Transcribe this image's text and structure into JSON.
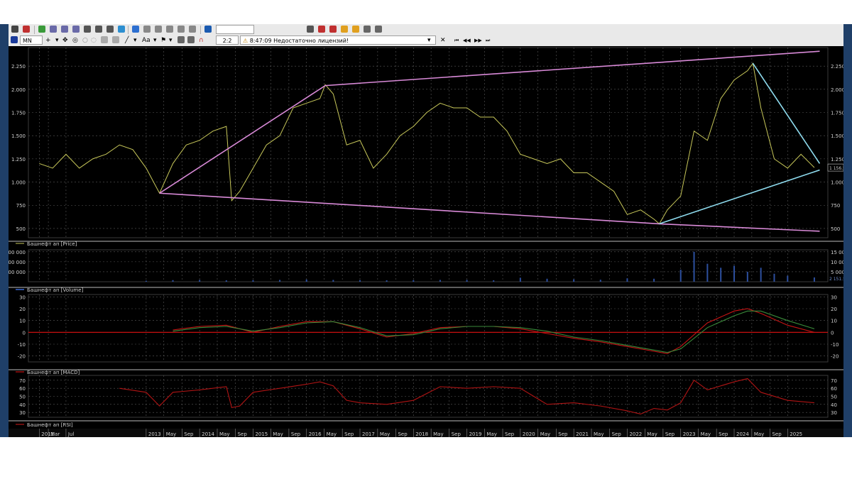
{
  "toolbar": {
    "timeframe": "MN",
    "ratio": "2:2",
    "aa_label": "Aa",
    "status_time": "8:47:09",
    "status_message": "Недостаточно лицензий!",
    "nav_labels": [
      "⏮",
      "◀◀",
      "▶▶",
      "⏭"
    ]
  },
  "colors": {
    "background": "#000000",
    "grid": "#5a5a5a",
    "price_line": "#c8c85a",
    "trend_pink": "#d98ad8",
    "trend_cyan": "#8fdcef",
    "volume_bar": "#2d4f9e",
    "macd_red": "#c81414",
    "macd_green": "#3a8a3a",
    "rsi_red": "#b01414"
  },
  "panels": {
    "price_legend": "Башнефт ап [Price]",
    "volume_legend": "Башнефт ап [Volume]",
    "macd_legend": "Башнефт ап [MACD]",
    "rsi_legend": "Башнефт ап [RSI]",
    "last_price_label": "1 156.5",
    "volume_last_label": "2 151.5"
  },
  "chart_data": [
    {
      "type": "line",
      "panel": "price",
      "series": [
        {
          "name": "Башнефт ап [Price]",
          "x": [
            2011.0,
            2011.25,
            2011.5,
            2011.75,
            2012.0,
            2012.25,
            2012.5,
            2012.75,
            2013.0,
            2013.25,
            2013.5,
            2013.75,
            2014.0,
            2014.25,
            2014.5,
            2014.6,
            2014.75,
            2015.0,
            2015.25,
            2015.5,
            2015.75,
            2016.0,
            2016.25,
            2016.35,
            2016.5,
            2016.75,
            2017.0,
            2017.25,
            2017.5,
            2017.75,
            2018.0,
            2018.25,
            2018.5,
            2018.75,
            2019.0,
            2019.25,
            2019.5,
            2019.75,
            2020.0,
            2020.25,
            2020.5,
            2020.75,
            2021.0,
            2021.25,
            2021.5,
            2021.75,
            2022.0,
            2022.25,
            2022.5,
            2022.6,
            2022.75,
            2023.0,
            2023.25,
            2023.5,
            2023.75,
            2024.0,
            2024.25,
            2024.35,
            2024.5,
            2024.75,
            2025.0,
            2025.25,
            2025.5
          ],
          "values": [
            1200,
            1150,
            1300,
            1150,
            1250,
            1300,
            1400,
            1350,
            1150,
            880,
            1200,
            1400,
            1450,
            1550,
            1600,
            800,
            900,
            1150,
            1400,
            1500,
            1800,
            1850,
            1900,
            2050,
            1950,
            1400,
            1450,
            1150,
            1300,
            1500,
            1600,
            1750,
            1850,
            1800,
            1800,
            1700,
            1700,
            1550,
            1300,
            1250,
            1200,
            1250,
            1100,
            1100,
            1000,
            900,
            650,
            700,
            600,
            550,
            700,
            850,
            1550,
            1450,
            1900,
            2100,
            2200,
            2280,
            1800,
            1250,
            1150,
            1300,
            1156.5
          ]
        },
        {
          "name": "",
          "x": [
            2013.25,
            2016.35,
            2025.6
          ],
          "values": [
            880,
            2040,
            2410
          ]
        },
        {
          "name": "",
          "x": [
            2013.25,
            2022.6,
            2025.6
          ],
          "values": [
            880,
            550,
            470
          ]
        },
        {
          "name": "",
          "x": [
            2024.35,
            2025.6
          ],
          "values": [
            2280,
            1200
          ]
        },
        {
          "name": "",
          "x": [
            2022.6,
            2025.6
          ],
          "values": [
            550,
            1130
          ]
        }
      ],
      "yticks": [
        "2.250",
        "2.000",
        "1.750",
        "1.500",
        "1.250",
        "1.000",
        "750",
        "500"
      ],
      "ytick_values": [
        2250,
        2000,
        1750,
        1500,
        1250,
        1000,
        750,
        500
      ],
      "ylim": [
        400,
        2450
      ],
      "grid": true
    },
    {
      "type": "bar",
      "panel": "volume",
      "series": [
        {
          "name": "Башнефт ап [Volume]",
          "x": [
            2013.0,
            2013.5,
            2014.0,
            2014.5,
            2015.0,
            2015.5,
            2016.0,
            2016.5,
            2017.0,
            2017.5,
            2018.0,
            2018.5,
            2019.0,
            2019.5,
            2020.0,
            2020.5,
            2021.0,
            2021.5,
            2022.0,
            2022.5,
            2023.0,
            2023.25,
            2023.5,
            2023.75,
            2024.0,
            2024.25,
            2024.5,
            2024.75,
            2025.0,
            2025.5
          ],
          "values": [
            500,
            800,
            900,
            700,
            800,
            900,
            1100,
            900,
            800,
            700,
            800,
            900,
            900,
            700,
            2000,
            1500,
            1200,
            1000,
            1700,
            1500,
            6000,
            15000,
            9000,
            7000,
            8000,
            5000,
            7000,
            4000,
            3000,
            2151.5
          ]
        }
      ],
      "yticks_left": [
        "0 000 000",
        "0 000 000",
        "0 000 000"
      ],
      "yticks_right": [
        "15 000",
        "10 000",
        "5 000.00"
      ],
      "ylim": [
        0,
        16000
      ]
    },
    {
      "type": "line",
      "panel": "macd",
      "series": [
        {
          "name": "Башнефт ап [MACD]",
          "x": [
            2013.5,
            2014.0,
            2014.5,
            2015.0,
            2015.5,
            2016.0,
            2016.5,
            2017.0,
            2017.5,
            2018.0,
            2018.5,
            2019.0,
            2019.5,
            2020.0,
            2020.5,
            2021.0,
            2021.5,
            2022.0,
            2022.5,
            2022.75,
            2023.0,
            2023.5,
            2024.0,
            2024.25,
            2024.5,
            2025.0,
            2025.5
          ],
          "values": [
            2,
            5,
            6,
            0,
            5,
            9,
            9,
            3,
            -4,
            -1,
            4,
            5,
            5,
            3,
            -1,
            -5,
            -8,
            -12,
            -16,
            -18,
            -12,
            8,
            18,
            20,
            16,
            6,
            0
          ]
        },
        {
          "name": "",
          "x": [
            2013.5,
            2014.0,
            2014.5,
            2015.0,
            2015.5,
            2016.0,
            2016.5,
            2017.0,
            2017.5,
            2018.0,
            2018.5,
            2019.0,
            2019.5,
            2020.0,
            2020.5,
            2021.0,
            2021.5,
            2022.0,
            2022.5,
            2022.75,
            2023.0,
            2023.5,
            2024.0,
            2024.25,
            2024.5,
            2025.0,
            2025.5
          ],
          "values": [
            1,
            4,
            5,
            1,
            4,
            8,
            9,
            4,
            -3,
            -2,
            3,
            5,
            5,
            4,
            1,
            -4,
            -7,
            -11,
            -15,
            -17,
            -14,
            4,
            14,
            18,
            18,
            10,
            3
          ]
        },
        {
          "name": "",
          "x": [
            2013.5,
            2025.5
          ],
          "values": [
            0,
            0
          ]
        }
      ],
      "yticks": [
        "30",
        "20",
        "10",
        "0",
        "-10",
        "-20"
      ],
      "ytick_values": [
        30,
        20,
        10,
        0,
        -10,
        -20
      ],
      "ylim": [
        -25,
        32
      ]
    },
    {
      "type": "line",
      "panel": "rsi",
      "series": [
        {
          "name": "Башнефт ап [RSI]",
          "x": [
            2012.5,
            2013.0,
            2013.25,
            2013.5,
            2014.0,
            2014.5,
            2014.6,
            2014.75,
            2015.0,
            2015.5,
            2016.0,
            2016.25,
            2016.5,
            2016.75,
            2017.0,
            2017.5,
            2018.0,
            2018.5,
            2019.0,
            2019.5,
            2020.0,
            2020.5,
            2021.0,
            2021.5,
            2022.0,
            2022.25,
            2022.5,
            2022.75,
            2023.0,
            2023.25,
            2023.5,
            2024.0,
            2024.25,
            2024.5,
            2025.0,
            2025.5
          ],
          "values": [
            60,
            55,
            38,
            55,
            58,
            62,
            36,
            38,
            55,
            60,
            65,
            68,
            63,
            45,
            42,
            40,
            45,
            62,
            60,
            62,
            60,
            40,
            42,
            38,
            32,
            28,
            35,
            33,
            42,
            70,
            58,
            68,
            72,
            55,
            45,
            42
          ]
        }
      ],
      "yticks": [
        "70",
        "60",
        "50",
        "40",
        "30"
      ],
      "ytick_values": [
        70,
        60,
        50,
        40,
        30
      ],
      "ylim": [
        24,
        76
      ]
    }
  ],
  "time_axis": {
    "labels": [
      "2011",
      "Mar",
      "Jul",
      "2013",
      "May",
      "Sep",
      "2014",
      "May",
      "Sep",
      "2015",
      "May",
      "Sep",
      "2016",
      "May",
      "Sep",
      "2017",
      "May",
      "Sep",
      "2018",
      "May",
      "Sep",
      "2019",
      "May",
      "Sep",
      "2020",
      "May",
      "Sep",
      "2021",
      "May",
      "Sep",
      "2022",
      "May",
      "Sep",
      "2023",
      "May",
      "Sep",
      "2024",
      "May",
      "Sep",
      "2025"
    ],
    "positions": [
      2011.0,
      2011.17,
      2011.5,
      2013.0,
      2013.33,
      2013.67,
      2014.0,
      2014.33,
      2014.67,
      2015.0,
      2015.33,
      2015.67,
      2016.0,
      2016.33,
      2016.67,
      2017.0,
      2017.33,
      2017.67,
      2018.0,
      2018.33,
      2018.67,
      2019.0,
      2019.33,
      2019.67,
      2020.0,
      2020.33,
      2020.67,
      2021.0,
      2021.33,
      2021.67,
      2022.0,
      2022.33,
      2022.67,
      2023.0,
      2023.33,
      2023.67,
      2024.0,
      2024.33,
      2024.67,
      2025.0
    ]
  }
}
